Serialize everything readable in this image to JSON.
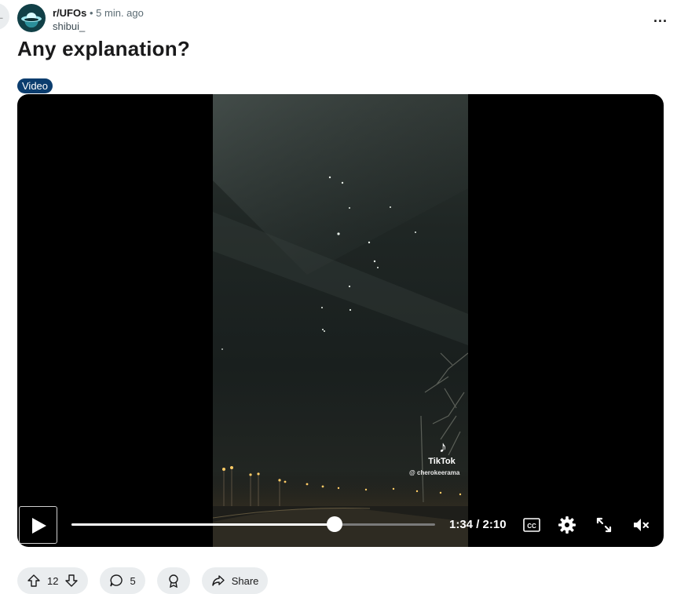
{
  "post": {
    "subreddit": "r/UFOs",
    "separator": "•",
    "time_ago": "5 min. ago",
    "author": "shibui_",
    "more_label": "...",
    "title": "Any explanation?",
    "flair": "Video"
  },
  "video": {
    "watermark_brand": "TikTok",
    "watermark_handle": "@ cherokeerama",
    "time_display": "1:34 / 2:10",
    "progress": 0.723,
    "state": "paused",
    "muted": true
  },
  "icons": {
    "back": "back-arrow-icon",
    "play": "play-icon",
    "cc": "closed-captions-icon",
    "settings": "gear-icon",
    "fullscreen": "fullscreen-icon",
    "mute": "volume-muted-icon",
    "upvote": "upvote-icon",
    "downvote": "downvote-icon",
    "comment": "comment-icon",
    "award": "award-icon",
    "share": "share-icon"
  },
  "actions": {
    "vote_count": "12",
    "comment_count": "5",
    "share_label": "Share"
  },
  "colors": {
    "flair_bg": "#0b3d6e",
    "pill_bg": "#eaedef"
  }
}
